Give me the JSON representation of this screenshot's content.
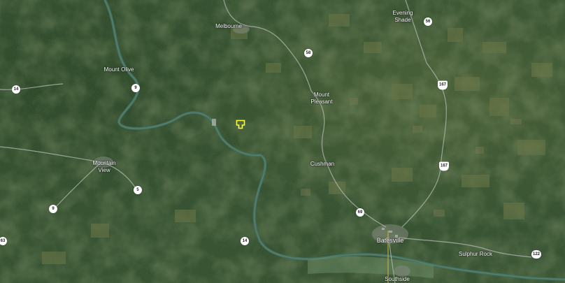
{
  "map": {
    "type": "satellite",
    "colors": {
      "forest": "#2f4a2b",
      "river": "#3f6a5f",
      "road": "#c9c9c9",
      "marker": "#ffff33"
    }
  },
  "places": {
    "melbourne": "Melbourne",
    "evening_shade": "Evening\nShade",
    "mount_olive": "Mount Olive",
    "mount_pleasant": "Mount\nPleasant",
    "cushman": "Cushman",
    "mountain_view": "Mountain\nView",
    "batesville": "Batesville",
    "sulphur_rock": "Sulphur Rock",
    "southside": "Southside"
  },
  "routes": {
    "r14_west": "14",
    "r9_north": "9",
    "r58": "58",
    "r56": "56",
    "r167_north": "167",
    "r167_south": "167",
    "r5": "5",
    "r9_south": "9",
    "r69": "69",
    "r14_south": "14",
    "r122": "122",
    "r63_edge": "63"
  },
  "marker": {
    "icon": "parcel-marker-icon"
  }
}
